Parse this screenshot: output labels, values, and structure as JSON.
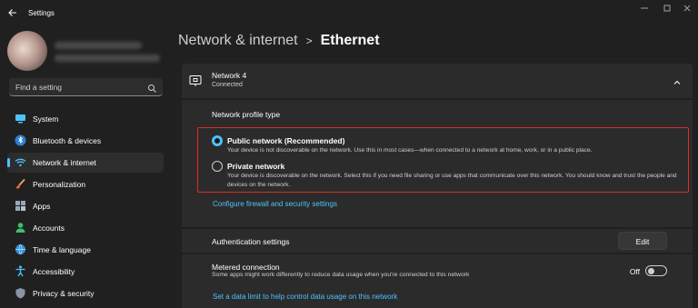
{
  "window": {
    "title": "Settings",
    "controls": [
      "minimize-icon",
      "maximize-icon",
      "close-icon"
    ]
  },
  "sidebar": {
    "search": {
      "placeholder": "Find a setting"
    },
    "items": [
      {
        "label": "System",
        "icon": "system-icon",
        "active": false
      },
      {
        "label": "Bluetooth & devices",
        "icon": "bluetooth-icon",
        "active": false
      },
      {
        "label": "Network & internet",
        "icon": "wifi-icon",
        "active": true
      },
      {
        "label": "Personalization",
        "icon": "brush-icon",
        "active": false
      },
      {
        "label": "Apps",
        "icon": "apps-icon",
        "active": false
      },
      {
        "label": "Accounts",
        "icon": "accounts-icon",
        "active": false
      },
      {
        "label": "Time & language",
        "icon": "globe-icon",
        "active": false
      },
      {
        "label": "Accessibility",
        "icon": "accessibility-icon",
        "active": false
      },
      {
        "label": "Privacy & security",
        "icon": "shield-icon",
        "active": false
      }
    ]
  },
  "header": {
    "breadcrumb_parent": "Network & internet",
    "separator": ">",
    "current": "Ethernet"
  },
  "network": {
    "name": "Network 4",
    "status": "Connected"
  },
  "profile": {
    "section_title": "Network profile type",
    "options": [
      {
        "title": "Public network (Recommended)",
        "description": "Your device is not discoverable on the network. Use this in most cases—when connected to a network at home, work, or in a public place.",
        "selected": true
      },
      {
        "title": "Private network",
        "description": "Your device is discoverable on the network. Select this if you need file sharing or use apps that communicate over this network. You should know and trust the people and devices on the network.",
        "selected": false
      }
    ],
    "firewall_link": "Configure firewall and security settings"
  },
  "auth": {
    "label": "Authentication settings",
    "button": "Edit"
  },
  "metered": {
    "label": "Metered connection",
    "description": "Some apps might work differently to reduce data usage when you're connected to this network",
    "state": "Off",
    "data_limit_link": "Set a data limit to help control data usage on this network"
  },
  "colors": {
    "accent": "#4cc2ff",
    "highlight_border": "#e02b27",
    "background": "#202020",
    "panel": "#2b2b2b"
  }
}
